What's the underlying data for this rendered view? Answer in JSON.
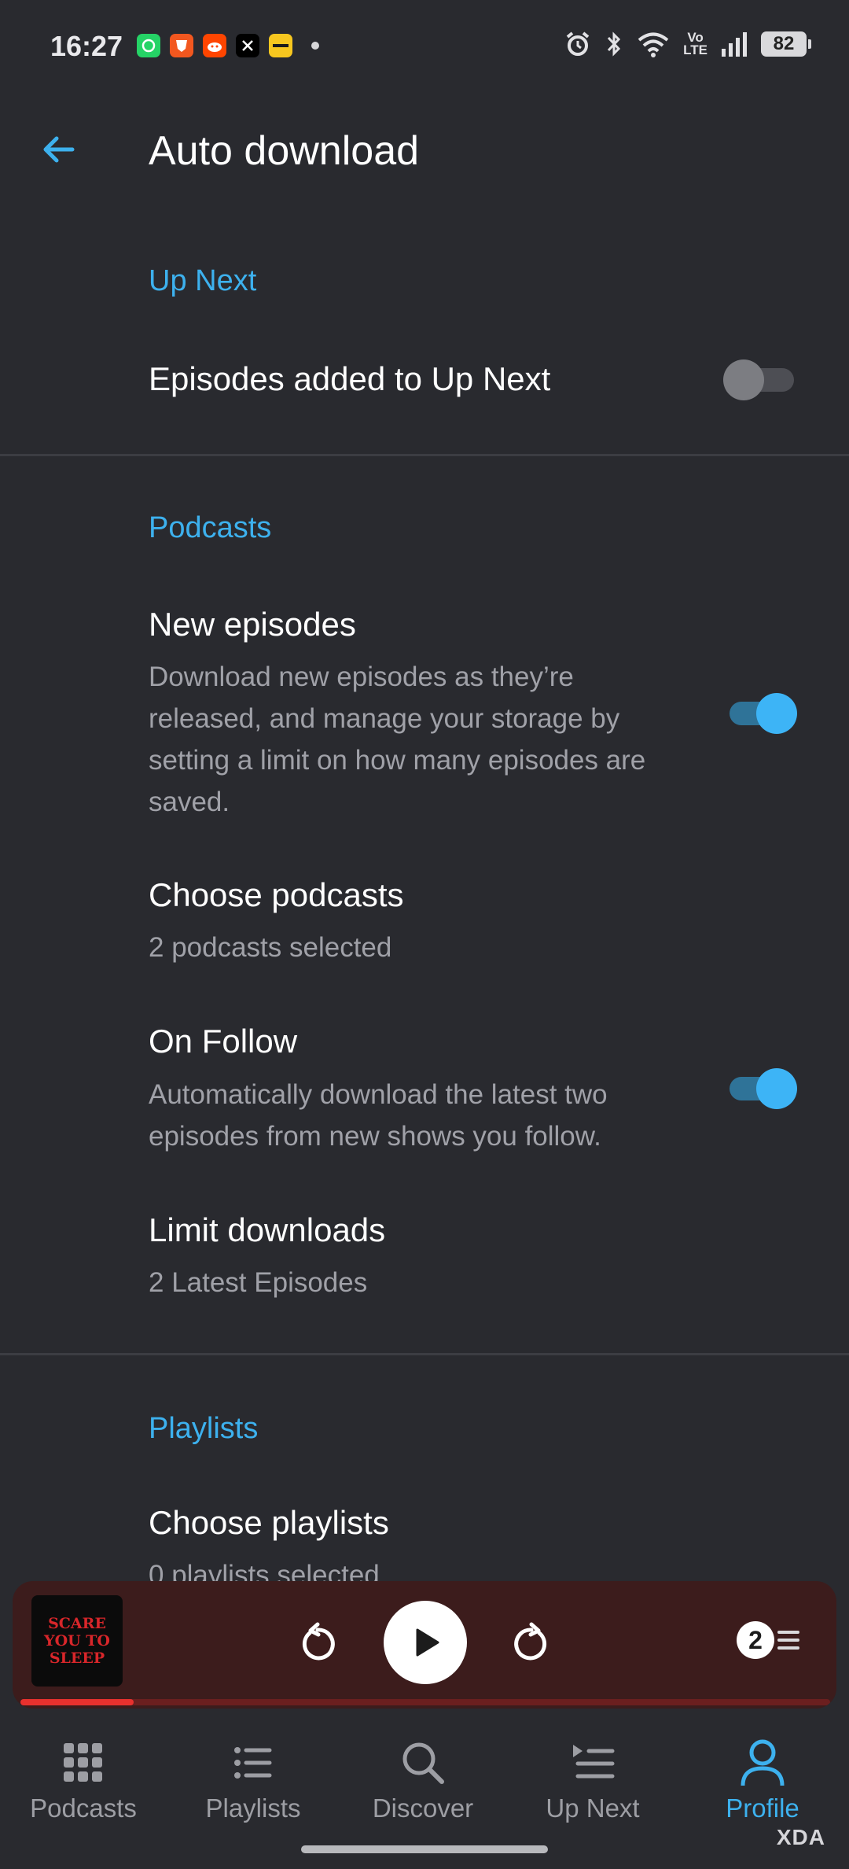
{
  "status_bar": {
    "time": "16:27",
    "notification_icons": [
      {
        "name": "whatsapp-icon",
        "color": "#25d366"
      },
      {
        "name": "brave-icon",
        "color": "#f2571f"
      },
      {
        "name": "reddit-icon",
        "color": "#ff4500"
      },
      {
        "name": "x-icon",
        "color": "#000000"
      },
      {
        "name": "blinkit-icon",
        "color": "#f7c71f"
      }
    ],
    "network_label": "Vo\nLTE",
    "battery": "82"
  },
  "header": {
    "back_icon": "arrow-left-icon",
    "title": "Auto download"
  },
  "up_next_section": {
    "title": "Up Next",
    "episodes_added": {
      "label": "Episodes added to Up Next",
      "enabled": false
    }
  },
  "podcasts_section": {
    "title": "Podcasts",
    "new_episodes": {
      "label": "New episodes",
      "description": "Download new episodes as they’re released, and manage your storage by setting a limit on how many episodes are saved.",
      "enabled": true
    },
    "choose_podcasts": {
      "label": "Choose podcasts",
      "value": "2 podcasts selected"
    },
    "on_follow": {
      "label": "On Follow",
      "description": "Automatically download the latest two episodes from new shows you follow.",
      "enabled": true
    },
    "limit_downloads": {
      "label": "Limit downloads",
      "value": "2 Latest Episodes"
    }
  },
  "playlists_section": {
    "title": "Playlists",
    "choose_playlists": {
      "label": "Choose playlists",
      "value": "0 playlists selected"
    }
  },
  "mini_player": {
    "artwork_text": [
      "SCARE",
      "YOU TO",
      "SLEEP"
    ],
    "up_next_count": "2",
    "progress": 0.14,
    "accent_color": "#e8312e"
  },
  "bottom_nav": {
    "items": [
      {
        "label": "Podcasts",
        "icon": "grid-icon",
        "active": false
      },
      {
        "label": "Playlists",
        "icon": "list-icon",
        "active": false
      },
      {
        "label": "Discover",
        "icon": "search-icon",
        "active": false
      },
      {
        "label": "Up Next",
        "icon": "queue-icon",
        "active": false
      },
      {
        "label": "Profile",
        "icon": "person-icon",
        "active": true
      }
    ]
  },
  "watermark": "XDA",
  "colors": {
    "background": "#292a2f",
    "accent": "#3db1ee",
    "subtitle": "#a0a1a8"
  }
}
